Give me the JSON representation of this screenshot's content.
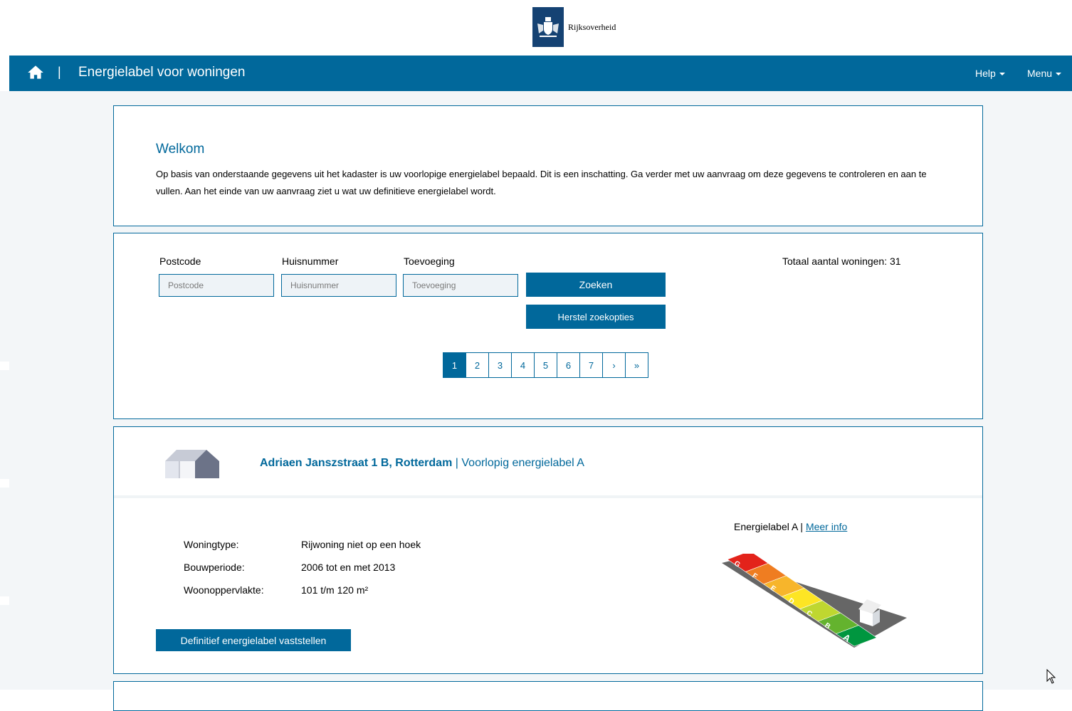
{
  "header": {
    "org_name": "Rijksoverheid",
    "app_title": "Energielabel voor woningen",
    "separator": "|",
    "nav": {
      "help": "Help",
      "menu": "Menu"
    }
  },
  "welcome": {
    "title": "Welkom",
    "text": "Op basis van onderstaande gegevens uit het kadaster is uw voorlopige energielabel bepaald. Dit is een inschatting. Ga verder met uw aanvraag om deze gegevens te controleren en aan te vullen. Aan het einde van uw aanvraag ziet u wat uw definitieve energielabel wordt."
  },
  "search": {
    "postcode_label": "Postcode",
    "postcode_placeholder": "Postcode",
    "postcode_value": "",
    "huisnummer_label": "Huisnummer",
    "huisnummer_placeholder": "Huisnummer",
    "huisnummer_value": "",
    "toevoeging_label": "Toevoeging",
    "toevoeging_placeholder": "Toevoeging",
    "toevoeging_value": "",
    "search_button": "Zoeken",
    "reset_button": "Herstel zoekopties",
    "total": "Totaal aantal woningen: 31"
  },
  "pagination": {
    "pages": [
      "1",
      "2",
      "3",
      "4",
      "5",
      "6",
      "7"
    ],
    "next": "›",
    "last": "»",
    "active_page": "1"
  },
  "result": {
    "address": "Adriaen Janszstraat 1 B, Rotterdam",
    "separator": "|",
    "label_text": "Voorlopig energielabel A",
    "details": [
      {
        "label": "Woningtype:",
        "value": "Rijwoning niet op een hoek"
      },
      {
        "label": "Bouwperiode:",
        "value": "2006 tot en met 2013"
      },
      {
        "label": "Woonoppervlakte:",
        "value": "101 t/m 120 m²"
      }
    ],
    "energy_caption": "Energielabel A |",
    "more_info": "Meer info",
    "energy_scale": [
      "G",
      "F",
      "E",
      "D",
      "C",
      "B",
      "A"
    ],
    "energy_colors": [
      "#e3231b",
      "#ef7d21",
      "#f7b52b",
      "#fde524",
      "#bfd730",
      "#64b32e",
      "#00963f"
    ],
    "final_button": "Definitief energielabel vaststellen"
  },
  "icons": {
    "home": "home-icon",
    "house": "house-icon",
    "logo": "rijksoverheid-logo-icon",
    "cursor": "mouse-cursor-icon"
  },
  "colors": {
    "brand": "#01689b",
    "background": "#f3f6f8",
    "logo": "#154273"
  }
}
